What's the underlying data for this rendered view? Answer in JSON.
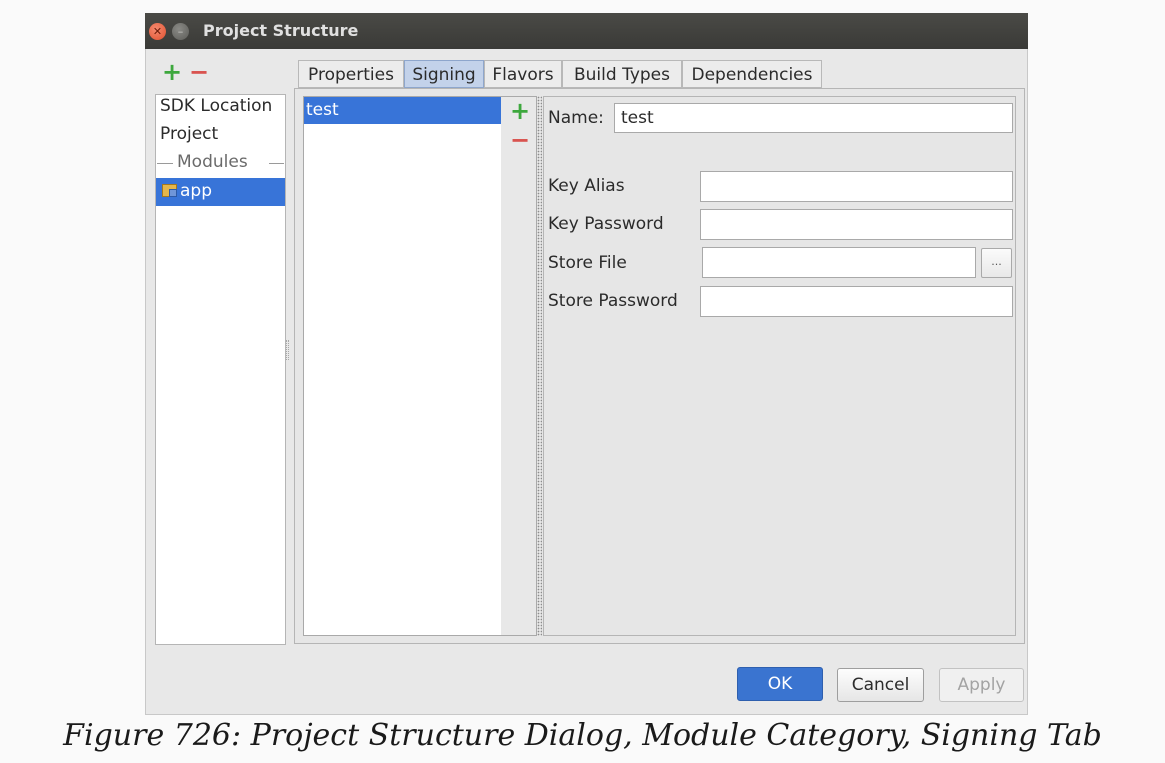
{
  "window": {
    "title": "Project Structure"
  },
  "icons": {
    "close": "close-icon",
    "minimize": "minimize-icon",
    "add": "plus-icon",
    "remove": "minus-icon",
    "module": "module-folder-icon"
  },
  "colors": {
    "selection": "#3874d8",
    "add": "#3da83d",
    "remove": "#d9534f",
    "ok_button": "#3a74d0",
    "title_bar": "#3c3b37"
  },
  "category_panel": {
    "add_glyph": "+",
    "remove_glyph": "−",
    "items": [
      "SDK Location",
      "Project"
    ],
    "modules_header": "Modules",
    "modules": [
      {
        "label": "app",
        "selected": true
      }
    ]
  },
  "tabs": [
    {
      "label": "Properties",
      "selected": false
    },
    {
      "label": "Signing",
      "selected": true
    },
    {
      "label": "Flavors",
      "selected": false
    },
    {
      "label": "Build Types",
      "selected": false
    },
    {
      "label": "Dependencies",
      "selected": false
    }
  ],
  "signing": {
    "configs": [
      {
        "label": "test",
        "selected": true
      }
    ],
    "add_glyph": "+",
    "remove_glyph": "−",
    "form": {
      "name_label": "Name:",
      "name_value": "test",
      "key_alias_label": "Key Alias",
      "key_alias_value": "",
      "key_password_label": "Key Password",
      "key_password_value": "",
      "store_file_label": "Store File",
      "store_file_value": "",
      "browse_label": "...",
      "store_password_label": "Store Password",
      "store_password_value": ""
    }
  },
  "buttons": {
    "ok": "OK",
    "cancel": "Cancel",
    "apply": "Apply",
    "apply_enabled": false
  },
  "caption": "Figure 726: Project Structure Dialog, Module Category, Signing Tab"
}
